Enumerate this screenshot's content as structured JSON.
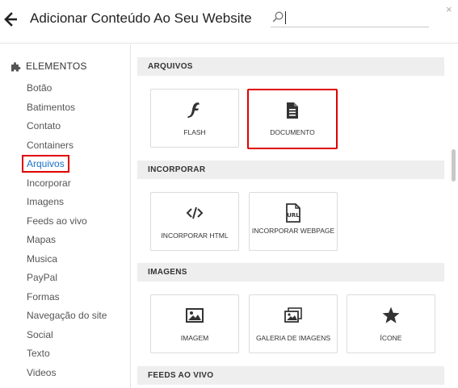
{
  "header": {
    "title": "Adicionar Conteúdo Ao Seu Website",
    "search_value": "",
    "close_symbol": "×"
  },
  "sidebar": {
    "heading": "ELEMENTOS",
    "items": [
      {
        "label": "Botão"
      },
      {
        "label": "Batimentos"
      },
      {
        "label": "Contato"
      },
      {
        "label": "Containers"
      },
      {
        "label": "Arquivos",
        "active": true
      },
      {
        "label": "Incorporar"
      },
      {
        "label": "Imagens"
      },
      {
        "label": "Feeds ao vivo"
      },
      {
        "label": "Mapas"
      },
      {
        "label": "Musica"
      },
      {
        "label": "PayPal"
      },
      {
        "label": "Formas"
      },
      {
        "label": "Navegação do site"
      },
      {
        "label": "Social"
      },
      {
        "label": "Texto"
      },
      {
        "label": "Videos"
      }
    ]
  },
  "main": {
    "sections": [
      {
        "title": "ARQUIVOS",
        "cards": [
          {
            "label": "FLASH",
            "icon": "flash-icon"
          },
          {
            "label": "DOCUMENTO",
            "icon": "document-icon",
            "highlighted": true
          }
        ]
      },
      {
        "title": "INCORPORAR",
        "cards": [
          {
            "label": "INCORPORAR HTML",
            "icon": "code-icon"
          },
          {
            "label": "INCORPORAR WEBPAGE",
            "icon": "url-icon"
          }
        ]
      },
      {
        "title": "IMAGENS",
        "cards": [
          {
            "label": "IMAGEM",
            "icon": "image-icon"
          },
          {
            "label": "GALERIA DE IMAGENS",
            "icon": "gallery-icon"
          },
          {
            "label": "ÍCONE",
            "icon": "star-icon"
          }
        ]
      },
      {
        "title": "FEEDS AO VIVO",
        "cards": []
      }
    ]
  },
  "colors": {
    "accent": "#1a73c8",
    "highlight_border": "#e00000",
    "section_bg": "#eeeeee"
  }
}
